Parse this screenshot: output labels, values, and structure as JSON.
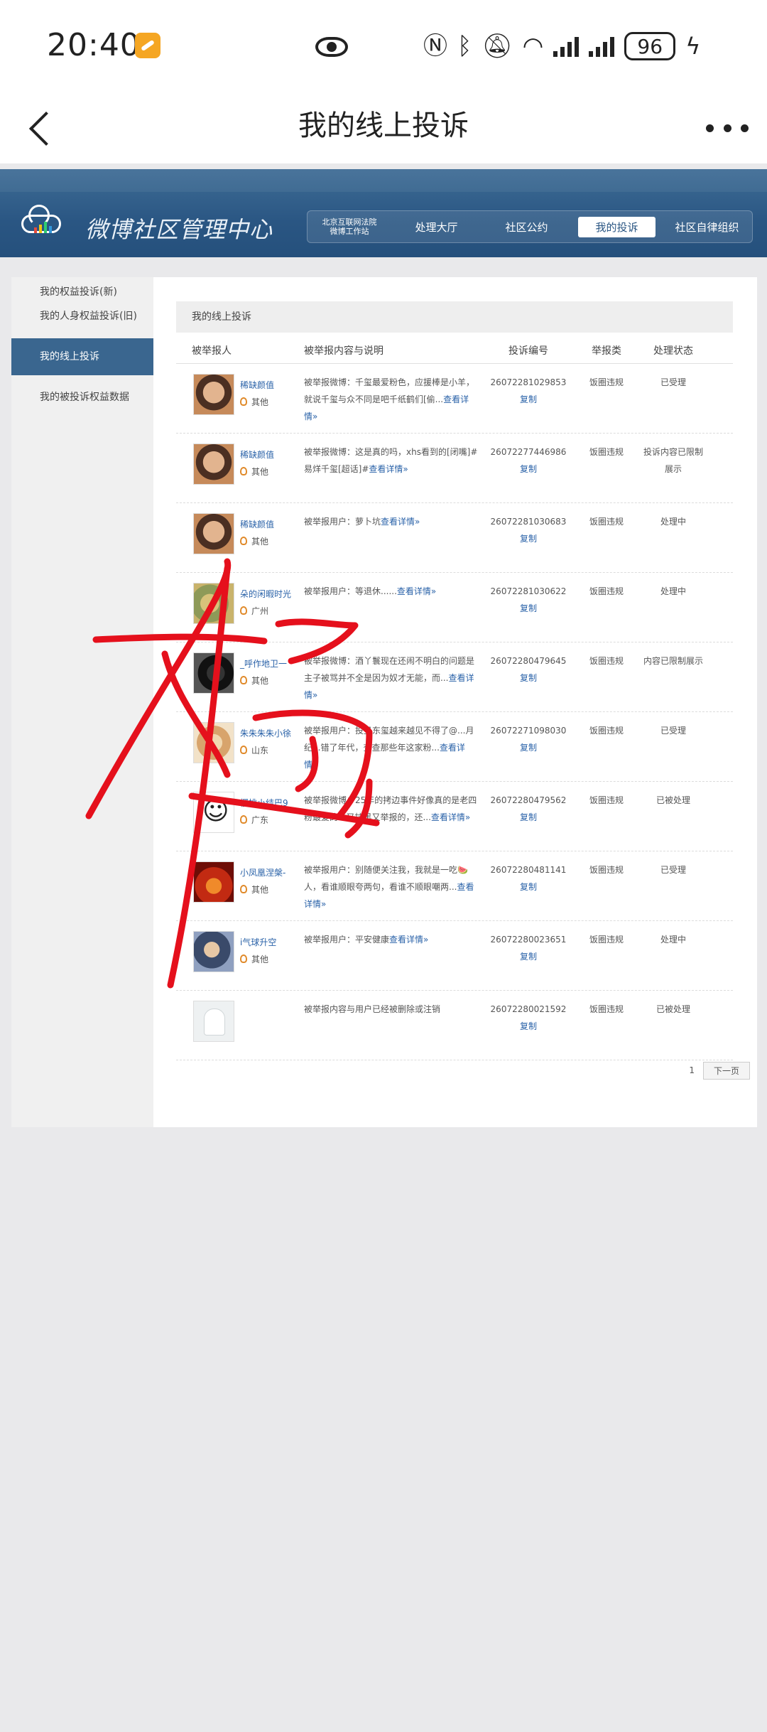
{
  "status_bar": {
    "time": "20:40",
    "battery": "96",
    "network": "6"
  },
  "header": {
    "title": "我的线上投诉"
  },
  "banner": {
    "title": "微博社区管理中心",
    "court_line1": "北京互联网法院",
    "court_line2": "微博工作站",
    "nav": [
      "处理大厅",
      "社区公约",
      "我的投诉",
      "社区自律组织"
    ],
    "active_nav": "我的投诉"
  },
  "sidebar": {
    "items": [
      "我的权益投诉(新)",
      "我的人身权益投诉(旧)",
      "我的线上投诉",
      "我的被投诉权益数据"
    ],
    "active": "我的线上投诉"
  },
  "content": {
    "title": "我的线上投诉",
    "columns": [
      "被举报人",
      "被举报内容与说明",
      "投诉编号",
      "举报类",
      "处理状态"
    ],
    "copy_label": "复制",
    "rows": [
      {
        "name": "稀缺颜值",
        "location": "其他",
        "content": "被举报微博：千玺最爱粉色，应援棒是小羊，就说千玺与众不同是吧千纸鹤们[偷...",
        "detail": "查看详情»",
        "id": "26072281029853",
        "type": "饭圈违规",
        "status": "已受理"
      },
      {
        "name": "稀缺颜值",
        "location": "其他",
        "content": "被举报微博：这是真的吗，xhs看到的[闭嘴]#易烊千玺[超话]#",
        "detail": "查看详情»",
        "id": "26072277446986",
        "type": "饭圈违规",
        "status": "投诉内容已限制展示"
      },
      {
        "name": "稀缺颜值",
        "location": "其他",
        "content": "被举报用户：萝卜坑",
        "detail": "查看详情»",
        "id": "26072281030683",
        "type": "饭圈违规",
        "status": "处理中"
      },
      {
        "name": "朵的闲暇时光",
        "location": "广州",
        "content": "被举报用户：等退休......",
        "detail": "查看详情»",
        "id": "26072281030622",
        "type": "饭圈违规",
        "status": "处理中"
      },
      {
        "name": "_呼作地卫一",
        "location": "其他",
        "content": "被举报微博：酒丫鬟现在还闹不明白的问题是主子被骂并不全是因为奴才无能，而...",
        "detail": "查看详情»",
        "id": "26072280479645",
        "type": "饭圈违规",
        "status": "内容已限制展示"
      },
      {
        "name": "朱朱朱朱小徐",
        "location": "山东",
        "content": "被举报用户：投丑东玺越来越见不得了@...月纪...错了年代，查查那些年这家粉...",
        "detail": "查看详情»",
        "id": "26072271098030",
        "type": "饭圈违规",
        "status": "已受理"
      },
      {
        "name": "樱桃小结巴9",
        "location": "广东",
        "content": "被举报微博：25年的拷边事件好像真的是老四粉最爱的...又拉黑又举报的，还...",
        "detail": "查看详情»",
        "id": "26072280479562",
        "type": "饭圈违规",
        "status": "已被处理"
      },
      {
        "name": "小凤凰涅槃-",
        "location": "其他",
        "content": "被举报用户：别随便关注我，我就是一吃🍉人，看谁顺眼夸两句，看谁不顺眼嘲两...",
        "detail": "查看详情»",
        "id": "26072280481141",
        "type": "饭圈违规",
        "status": "已受理"
      },
      {
        "name": "i气球升空",
        "location": "其他",
        "content": "被举报用户：平安健康",
        "detail": "查看详情»",
        "id": "26072280023651",
        "type": "饭圈违规",
        "status": "处理中"
      },
      {
        "name": "",
        "location": "",
        "content": "被举报内容与用户已经被删除或注销",
        "detail": "",
        "id": "26072280021592",
        "type": "饭圈违规",
        "status": "已被处理"
      }
    ],
    "pager": {
      "page": "1",
      "next": "下一页"
    }
  },
  "colors": {
    "banner": "#2a5683",
    "active_side": "#3a668f",
    "link": "#2a62a8",
    "scribble": "#e5101c"
  },
  "icons": [
    "app-badge-icon",
    "eye-icon",
    "nfc-icon",
    "bluetooth-icon",
    "mute-bell-icon",
    "wifi-icon",
    "signal-icon",
    "battery-icon",
    "back-icon",
    "more-icon",
    "cloud-logo-icon",
    "location-pin-icon"
  ]
}
